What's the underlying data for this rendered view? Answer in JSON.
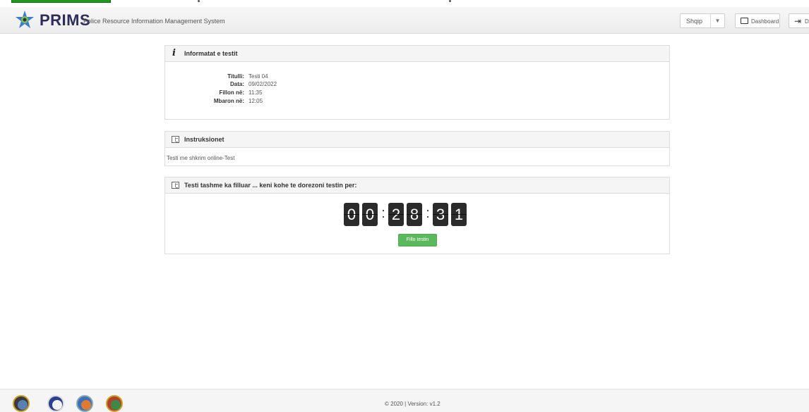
{
  "app": {
    "brand": "PRIMS",
    "subtitle": "Police Resource Information Management System"
  },
  "header": {
    "language": "Shqip",
    "dashboard_label": "Dashboard",
    "logout_label": "D"
  },
  "test_info": {
    "heading": "Informatat e testit",
    "rows": [
      {
        "label": "Titulli:",
        "value": "Testi 04"
      },
      {
        "label": "Data:",
        "value": "09/02/2022"
      },
      {
        "label": "Fillon në:",
        "value": "11:35"
      },
      {
        "label": "Mbaron në:",
        "value": "12:05"
      }
    ]
  },
  "instructions": {
    "heading": "Instruksionet",
    "text": "Testi me shkrim online-Test"
  },
  "countdown": {
    "heading": "Testi tashme ka filluar ... keni kohe te dorezoni testin per:",
    "digits": [
      "0",
      "0",
      "2",
      "8",
      "3",
      "1"
    ],
    "separator": ":",
    "start_button": "Fillo testin"
  },
  "footer": {
    "text": "© 2020  |  Version: v1.2"
  },
  "colors": {
    "accent_green": "#5cb85c",
    "brand_navy": "#2d2d5c",
    "digit_bg": "#2b2b2b"
  }
}
